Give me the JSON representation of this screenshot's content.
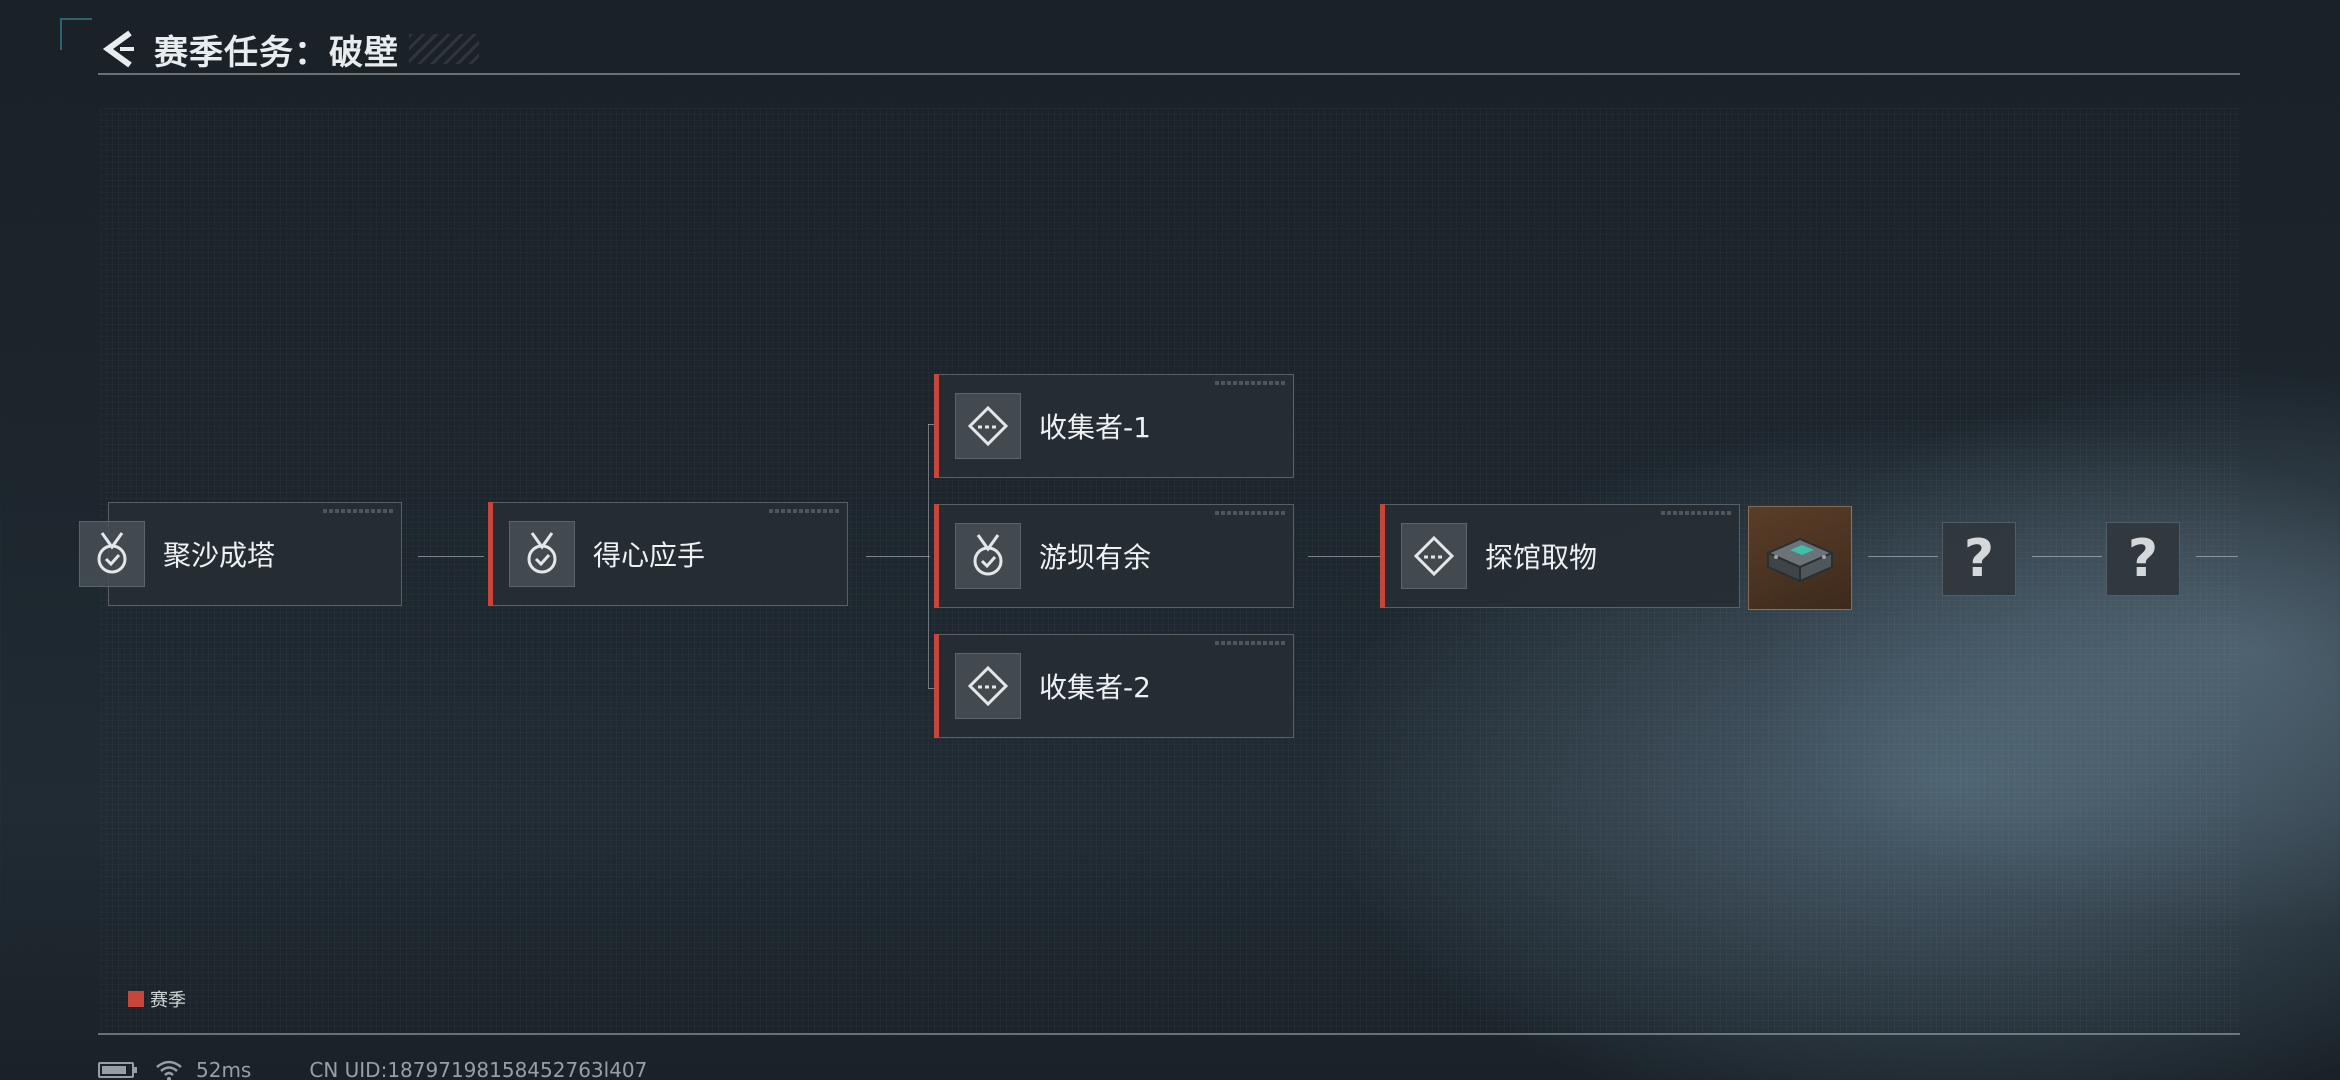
{
  "header": {
    "title": "赛季任务：破壁"
  },
  "tasks": [
    {
      "label": "聚沙成塔",
      "icon": "medal-check-icon"
    },
    {
      "label": "得心应手",
      "icon": "medal-check-icon"
    },
    {
      "label": "收集者-1",
      "icon": "diamond-tag-icon"
    },
    {
      "label": "游坝有余",
      "icon": "medal-check-icon"
    },
    {
      "label": "收集者-2",
      "icon": "diamond-tag-icon"
    },
    {
      "label": "探馆取物",
      "icon": "diamond-tag-icon"
    }
  ],
  "reward": {
    "icon": "supply-case-icon"
  },
  "locked": [
    {
      "symbol": "?"
    },
    {
      "symbol": "?"
    }
  ],
  "legend": {
    "label": "赛季",
    "color": "#c6463c"
  },
  "status": {
    "ping": "52ms",
    "uid": "CN UID:18797198158452763l407"
  }
}
